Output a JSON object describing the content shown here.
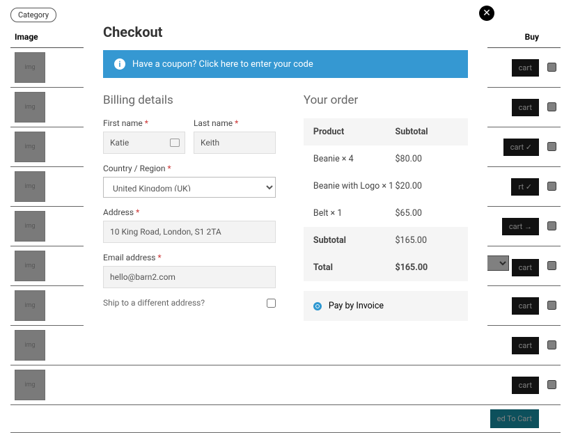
{
  "bg": {
    "category_label": "Category",
    "headers": {
      "image": "Image",
      "buy": "Buy"
    },
    "rows": [
      {
        "btn": "cart",
        "check": true
      },
      {
        "btn": "cart",
        "check": true
      },
      {
        "btn": "cart ✓",
        "check": true
      },
      {
        "btn": "rt ✓",
        "check": true,
        "arrow": true
      },
      {
        "btn": "cart →",
        "check": true
      },
      {
        "btn": "cart",
        "check": true,
        "select": true
      },
      {
        "btn": "cart",
        "check": true
      },
      {
        "btn": "cart",
        "check": true
      },
      {
        "btn": "cart",
        "check": true
      }
    ],
    "added_btn": "ed To Cart"
  },
  "modal": {
    "title": "Checkout",
    "coupon": "Have a coupon? Click here to enter your code",
    "billing_heading": "Billing details",
    "order_heading": "Your order",
    "fields": {
      "first_name": {
        "label": "First name",
        "value": "Katie"
      },
      "last_name": {
        "label": "Last name",
        "value": "Keith"
      },
      "country": {
        "label": "Country / Region",
        "value": "United Kingdom (UK)"
      },
      "address": {
        "label": "Address",
        "value": "10 King Road, London, S1 2TA"
      },
      "email": {
        "label": "Email address",
        "value": "hello@barn2.com"
      }
    },
    "ship_label": "Ship to a different address?",
    "order": {
      "headers": {
        "product": "Product",
        "subtotal": "Subtotal"
      },
      "items": [
        {
          "name": "Beanie  × 4",
          "subtotal": "$80.00"
        },
        {
          "name": "Beanie with Logo  × 1",
          "subtotal": "$20.00"
        },
        {
          "name": "Belt  × 1",
          "subtotal": "$65.00"
        }
      ],
      "subtotal": {
        "label": "Subtotal",
        "value": "$165.00"
      },
      "total": {
        "label": "Total",
        "value": "$165.00"
      }
    },
    "payment": "Pay by Invoice"
  }
}
